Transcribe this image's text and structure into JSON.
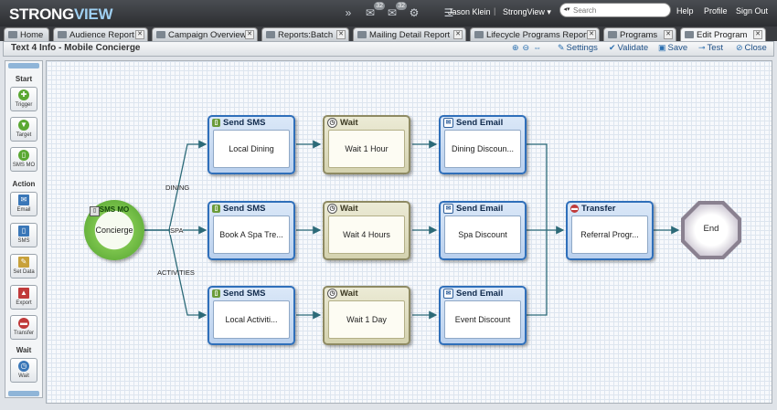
{
  "brand": {
    "logo_main": "STRONG",
    "logo_accent": "VIEW"
  },
  "topbar": {
    "badge_messages": "32",
    "badge_mail": "32",
    "user_name": "Jason Klein",
    "separator": "|",
    "org_name": "StrongView ▾",
    "search_placeholder": "Search",
    "help": "Help",
    "profile": "Profile",
    "sign_out": "Sign Out"
  },
  "tabs": [
    {
      "label": "Home"
    },
    {
      "label": "Audience Report"
    },
    {
      "label": "Campaign Overview"
    },
    {
      "label": "Reports:Batch"
    },
    {
      "label": "Mailing Detail Report"
    },
    {
      "label": "Lifecycle Programs Report"
    },
    {
      "label": "Programs"
    },
    {
      "label": "Edit Program"
    }
  ],
  "toolbar": {
    "page_title": "Text 4 Info - Mobile Concierge",
    "settings": "Settings",
    "validate": "Validate",
    "save": "Save",
    "test": "Test",
    "close": "Close"
  },
  "palette": {
    "sections": {
      "start": "Start",
      "action": "Action",
      "wait": "Wait"
    },
    "items": {
      "trigger": "Trigger",
      "target": "Target",
      "sms_mo": "SMS MO",
      "email": "Email",
      "sms": "SMS",
      "set_data": "Set Data",
      "export": "Export",
      "transfer": "Transfer",
      "wait": "Wait"
    }
  },
  "flow": {
    "start": {
      "type": "SMS MO",
      "label": "Concierge"
    },
    "branch_labels": {
      "dining": "DINING",
      "spa": "SPA",
      "activities": "ACTIVITIES"
    },
    "rows": [
      {
        "sms_title": "Send SMS",
        "sms_label": "Local Dining",
        "wait_title": "Wait",
        "wait_label": "Wait 1 Hour",
        "email_title": "Send Email",
        "email_label": "Dining Discoun..."
      },
      {
        "sms_title": "Send SMS",
        "sms_label": "Book A Spa Tre...",
        "wait_title": "Wait",
        "wait_label": "Wait 4 Hours",
        "email_title": "Send Email",
        "email_label": "Spa Discount"
      },
      {
        "sms_title": "Send SMS",
        "sms_label": "Local Activiti...",
        "wait_title": "Wait",
        "wait_label": "Wait 1 Day",
        "email_title": "Send Email",
        "email_label": "Event Discount"
      }
    ],
    "transfer": {
      "title": "Transfer",
      "label": "Referral Progr..."
    },
    "end": {
      "label": "End"
    }
  },
  "colors": {
    "sms_border": "#2f6fba",
    "wait_border": "#8e8a63",
    "start_green": "#4f9f2c",
    "end_gray": "#8a8190"
  }
}
